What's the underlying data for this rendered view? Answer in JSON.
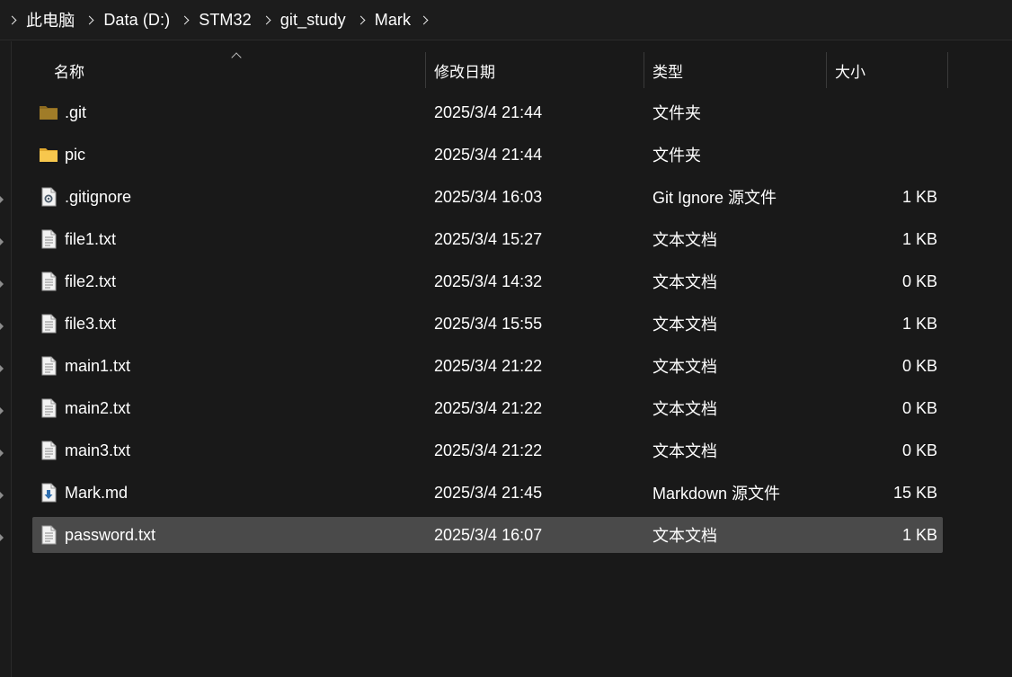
{
  "breadcrumb": [
    "此电脑",
    "Data (D:)",
    "STM32",
    "git_study",
    "Mark"
  ],
  "columns": {
    "name": "名称",
    "date": "修改日期",
    "type": "类型",
    "size": "大小"
  },
  "files": [
    {
      "name": ".git",
      "date": "2025/3/4 21:44",
      "type": "文件夹",
      "size": "",
      "icon": "folder-dim-icon"
    },
    {
      "name": "pic",
      "date": "2025/3/4 21:44",
      "type": "文件夹",
      "size": "",
      "icon": "folder-icon"
    },
    {
      "name": ".gitignore",
      "date": "2025/3/4 16:03",
      "type": "Git Ignore 源文件",
      "size": "1 KB",
      "icon": "gear-file-icon"
    },
    {
      "name": "file1.txt",
      "date": "2025/3/4 15:27",
      "type": "文本文档",
      "size": "1 KB",
      "icon": "text-file-icon"
    },
    {
      "name": "file2.txt",
      "date": "2025/3/4 14:32",
      "type": "文本文档",
      "size": "0 KB",
      "icon": "text-file-icon"
    },
    {
      "name": "file3.txt",
      "date": "2025/3/4 15:55",
      "type": "文本文档",
      "size": "1 KB",
      "icon": "text-file-icon"
    },
    {
      "name": "main1.txt",
      "date": "2025/3/4 21:22",
      "type": "文本文档",
      "size": "0 KB",
      "icon": "text-file-icon"
    },
    {
      "name": "main2.txt",
      "date": "2025/3/4 21:22",
      "type": "文本文档",
      "size": "0 KB",
      "icon": "text-file-icon"
    },
    {
      "name": "main3.txt",
      "date": "2025/3/4 21:22",
      "type": "文本文档",
      "size": "0 KB",
      "icon": "text-file-icon"
    },
    {
      "name": "Mark.md",
      "date": "2025/3/4 21:45",
      "type": "Markdown 源文件",
      "size": "15 KB",
      "icon": "markdown-file-icon"
    },
    {
      "name": "password.txt",
      "date": "2025/3/4 16:07",
      "type": "文本文档",
      "size": "1 KB",
      "icon": "text-file-icon",
      "selected": true
    }
  ]
}
